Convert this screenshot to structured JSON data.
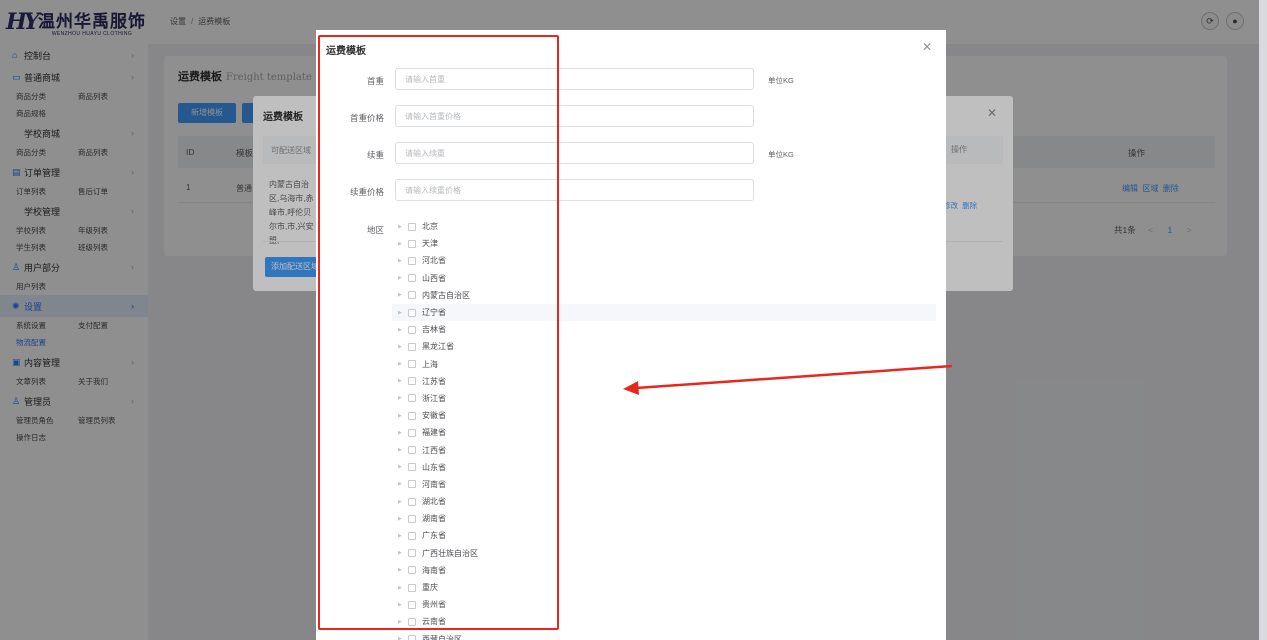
{
  "brand": {
    "cn": "温州华禹服饰",
    "en": "WENZHOU HUAYU CLOTHING",
    "mark": "HY"
  },
  "breadcrumb": {
    "parent": "设置",
    "sep": "/",
    "current": "运费模板"
  },
  "sidebar": [
    {
      "label": "控制台",
      "icon": "home-icon",
      "subs": []
    },
    {
      "label": "普通商城",
      "icon": "shop-icon",
      "subs": [
        "商品分类",
        "商品列表",
        "商品规格"
      ]
    },
    {
      "label": "学校商城",
      "icon": "",
      "subs": [
        "商品分类",
        "商品列表"
      ]
    },
    {
      "label": "订单管理",
      "icon": "order-icon",
      "subs": [
        "订单列表",
        "售后订单"
      ]
    },
    {
      "label": "学校管理",
      "icon": "",
      "subs": [
        "学校列表",
        "年级列表",
        "学生列表",
        "班级列表"
      ]
    },
    {
      "label": "用户部分",
      "icon": "user-icon",
      "subs": [
        "用户列表"
      ]
    },
    {
      "label": "设置",
      "icon": "gear-icon",
      "active": true,
      "subs": [
        "系统设置",
        "支付配置",
        "物流配置"
      ]
    },
    {
      "label": "内容管理",
      "icon": "doc-icon",
      "subs": [
        "文章列表",
        "关于我们"
      ]
    },
    {
      "label": "管理员",
      "icon": "admin-icon",
      "subs": [
        "管理员角色",
        "管理员列表",
        "操作日志"
      ]
    }
  ],
  "main": {
    "title": "运费模板",
    "title_en": "Freight template",
    "add_button": "新增模板",
    "columns": {
      "id": "ID",
      "name": "模板",
      "action": "操作"
    },
    "row": {
      "id": "1",
      "name": "普通",
      "edit": "编辑",
      "region": "区域",
      "delete": "删除"
    },
    "pager": {
      "total": "共1条",
      "prev": "<",
      "page": "1",
      "next": ">"
    }
  },
  "modal_back": {
    "title": "运费模板",
    "header_col": "可配送区域",
    "op_col": "操作",
    "region_text": "内蒙古自治区,乌海市,赤峰市,呼伦贝尔市,市,兴安盟,",
    "edit": "修改",
    "delete": "删除",
    "add_button": "添加配送区域"
  },
  "modal_front": {
    "title": "运费模板",
    "fields": [
      {
        "label": "首重",
        "placeholder": "请输入首重",
        "unit": "单位KG"
      },
      {
        "label": "首重价格",
        "placeholder": "请输入首重价格",
        "unit": ""
      },
      {
        "label": "续重",
        "placeholder": "请输入续重",
        "unit": "单位KG"
      },
      {
        "label": "续重价格",
        "placeholder": "请输入续重价格",
        "unit": ""
      }
    ],
    "region_label": "地区",
    "regions": [
      "北京",
      "天津",
      "河北省",
      "山西省",
      "内蒙古自治区",
      "辽宁省",
      "吉林省",
      "黑龙江省",
      "上海",
      "江苏省",
      "浙江省",
      "安徽省",
      "福建省",
      "江西省",
      "山东省",
      "河南省",
      "湖北省",
      "湖南省",
      "广东省",
      "广西壮族自治区",
      "海南省",
      "重庆",
      "贵州省",
      "云南省",
      "西藏自治区"
    ],
    "highlighted_region": "辽宁省"
  },
  "colors": {
    "primary": "#409eff",
    "annotation": "#e8271f",
    "active_menu_bg": "#e6eefc"
  }
}
